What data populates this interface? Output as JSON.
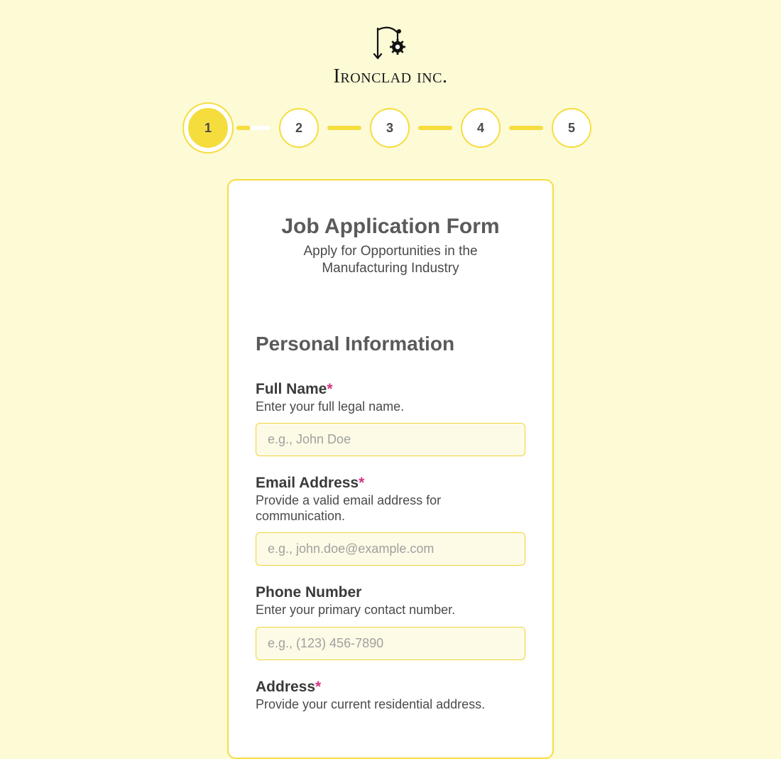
{
  "brand": {
    "name": "Ironclad inc."
  },
  "stepper": {
    "active_index": 0,
    "steps": [
      "1",
      "2",
      "3",
      "4",
      "5"
    ]
  },
  "form": {
    "title": "Job Application Form",
    "subtitle": "Apply for Opportunities in the Manufacturing Industry",
    "section_heading": "Personal Information",
    "fields": {
      "full_name": {
        "label": "Full Name",
        "required_mark": "*",
        "help": "Enter your full legal name.",
        "placeholder": "e.g., John Doe",
        "value": ""
      },
      "email": {
        "label": "Email Address",
        "required_mark": "*",
        "help": "Provide a valid email address for communication.",
        "placeholder": "e.g., john.doe@example.com",
        "value": ""
      },
      "phone": {
        "label": "Phone Number",
        "required_mark": "",
        "help": "Enter your primary contact number.",
        "placeholder": "e.g., (123) 456-7890",
        "value": ""
      },
      "address": {
        "label": "Address",
        "required_mark": "*",
        "help": "Provide your current residential address.",
        "placeholder": "",
        "value": ""
      }
    }
  },
  "colors": {
    "accent": "#f6dd3e",
    "bg": "#fdfad6",
    "required": "#d63384"
  }
}
